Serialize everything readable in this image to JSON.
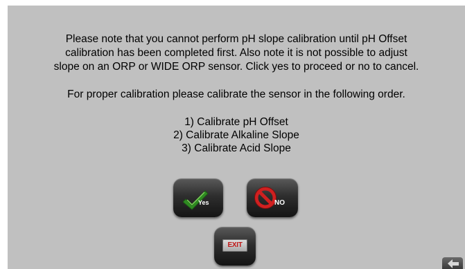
{
  "message": {
    "paragraph1": [
      "Please note that you cannot perform pH slope calibration until pH Offset",
      "calibration has been completed first. Also note it is not possible to adjust",
      "slope on an ORP or WIDE ORP sensor. Click yes to proceed or no to cancel."
    ],
    "paragraph2": "For proper calibration please calibrate the sensor in the following order.",
    "steps": [
      "1) Calibrate pH Offset",
      "2) Calibrate Alkaline Slope",
      "3) Calibrate Acid Slope"
    ]
  },
  "buttons": {
    "yes_label": "Yes",
    "no_label": "NO",
    "exit_label": "EXIT"
  },
  "icons": {
    "yes": "green-check-icon",
    "no": "red-prohibition-icon",
    "exit": "exit-sign-icon",
    "back": "back-arrow-icon"
  },
  "colors": {
    "background": "#c0c0c0",
    "check": "#3a9a2a",
    "no_sign": "#d02020",
    "exit_text": "#c01818"
  }
}
